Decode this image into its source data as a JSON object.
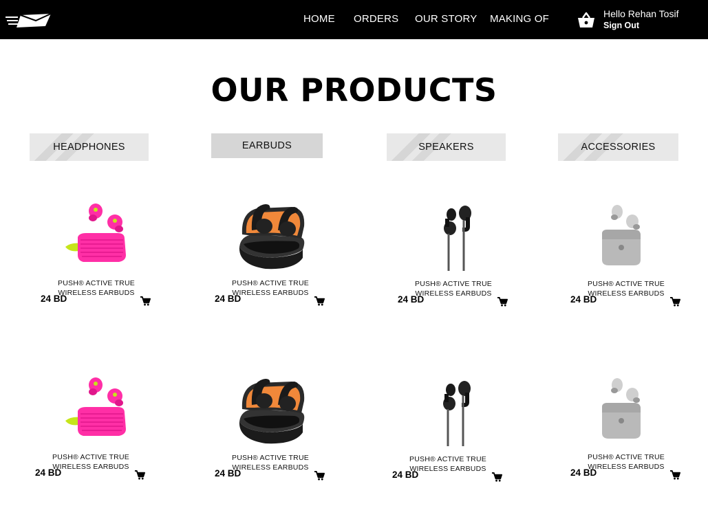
{
  "nav": {
    "links": [
      "HOME",
      "ORDERS",
      "OUR STORY",
      "MAKING OF"
    ],
    "greeting": "Hello Rehan Tosif",
    "signout": "Sign Out",
    "basket_icon": "shopping-basket-icon",
    "logo_icon": "envelope-speed-logo"
  },
  "page": {
    "title": "OUR PRODUCTS"
  },
  "categories": [
    {
      "label": "HEADPHONES",
      "active": false
    },
    {
      "label": "EARBUDS",
      "active": true
    },
    {
      "label": "SPEAKERS",
      "active": false
    },
    {
      "label": "ACCESSORIES",
      "active": false
    }
  ],
  "products": [
    {
      "name": "PUSH® ACTIVE TRUE WIRELESS EARBUDS",
      "price": "24 BD",
      "image": "pink-earbuds"
    },
    {
      "name": "PUSH® ACTIVE TRUE WIRELESS EARBUDS",
      "price": "24 BD",
      "image": "black-orange-earbuds"
    },
    {
      "name": "PUSH® ACTIVE TRUE WIRELESS EARBUDS",
      "price": "24 BD",
      "image": "black-wired-earphones"
    },
    {
      "name": "PUSH® ACTIVE TRUE WIRELESS EARBUDS",
      "price": "24 BD",
      "image": "grey-earbuds"
    },
    {
      "name": "PUSH® ACTIVE TRUE WIRELESS EARBUDS",
      "price": "24 BD",
      "image": "pink-earbuds"
    },
    {
      "name": "PUSH® ACTIVE TRUE WIRELESS EARBUDS",
      "price": "24 BD",
      "image": "black-orange-earbuds"
    },
    {
      "name": "PUSH® ACTIVE TRUE WIRELESS EARBUDS",
      "price": "24 BD",
      "image": "black-wired-earphones"
    },
    {
      "name": "PUSH® ACTIVE TRUE WIRELESS EARBUDS",
      "price": "24 BD",
      "image": "grey-earbuds"
    }
  ],
  "icons": {
    "cart": "shopping-cart-icon"
  },
  "colors": {
    "navbar": "#000000",
    "accent_pink": "#ff2fa6",
    "accent_lime": "#c6e51a",
    "accent_orange": "#f0883a"
  }
}
